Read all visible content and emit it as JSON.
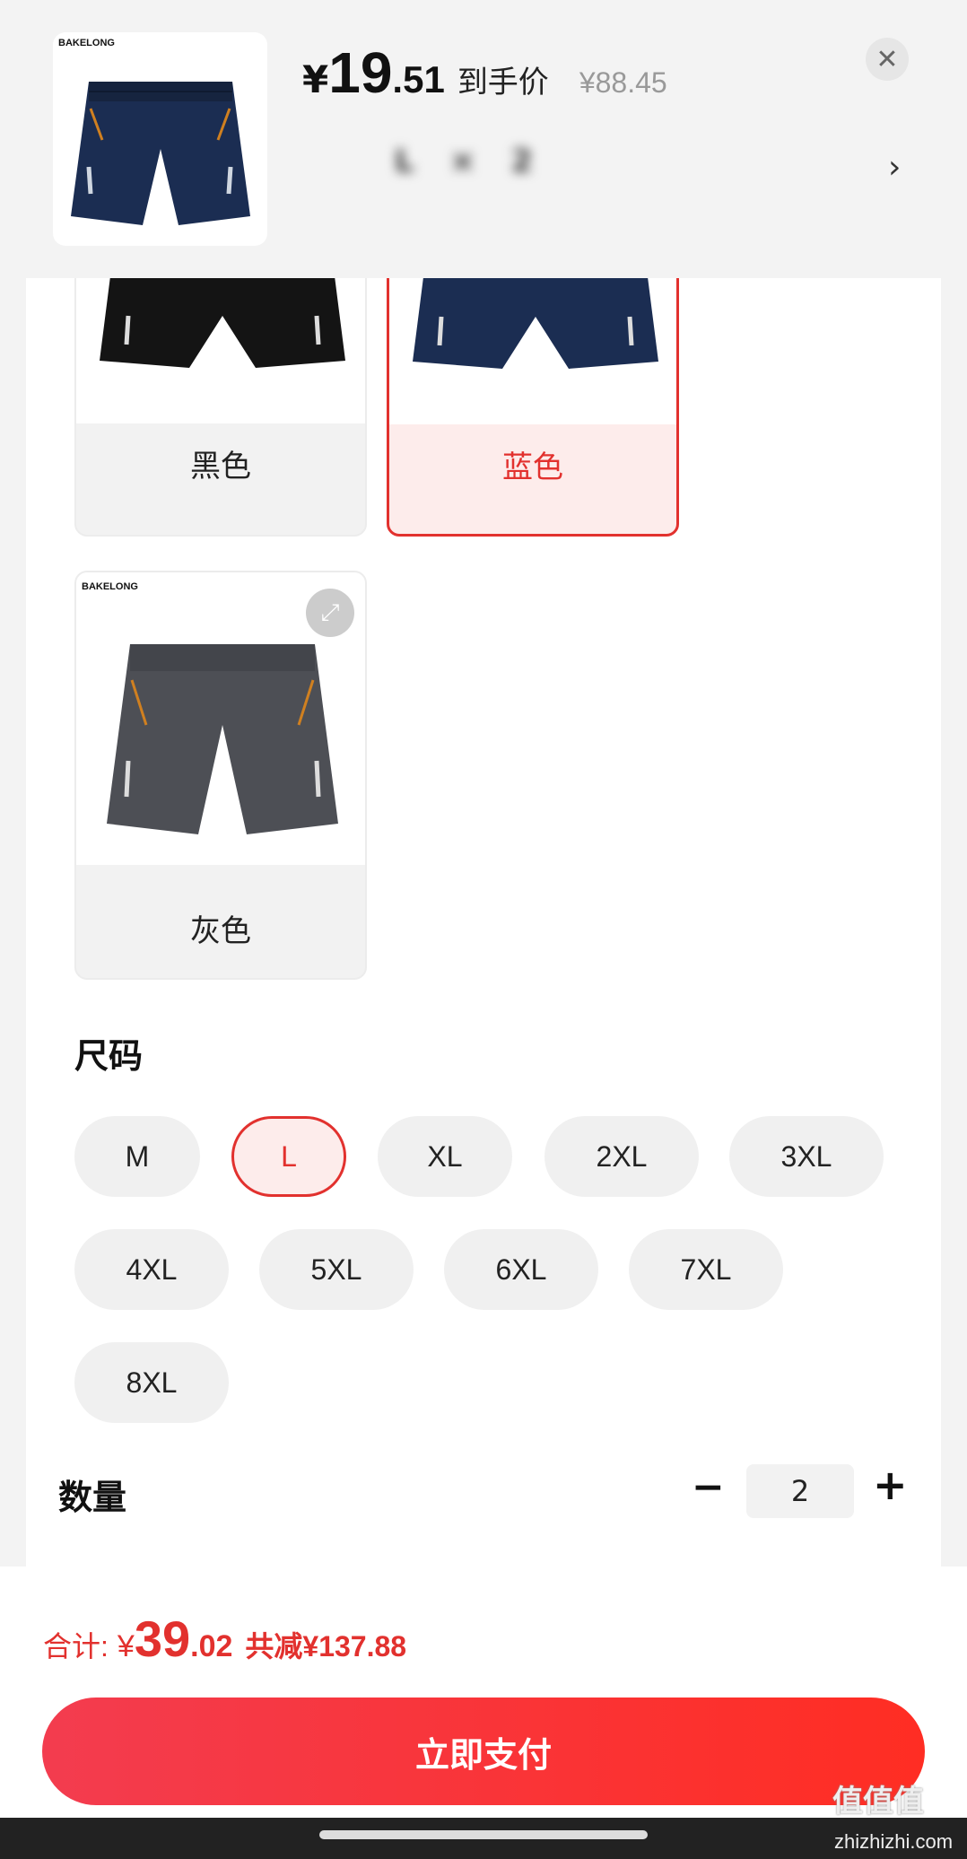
{
  "product": {
    "brand": "BAKELONG",
    "price_yen": "¥",
    "price_int": "19",
    "price_dec": ".51",
    "price_label": "到手价",
    "original_price": "¥88.45",
    "selected_summary": "L × 2"
  },
  "colors": {
    "options": [
      {
        "label": "黑色",
        "selected": false,
        "shorts_color": "#141414"
      },
      {
        "label": "蓝色",
        "selected": true,
        "shorts_color": "#1b2d52"
      },
      {
        "label": "灰色",
        "selected": false,
        "shorts_color": "#4d4f55"
      }
    ]
  },
  "sizes": {
    "title": "尺码",
    "options": [
      {
        "label": "M",
        "selected": false
      },
      {
        "label": "L",
        "selected": true
      },
      {
        "label": "XL",
        "selected": false
      },
      {
        "label": "2XL",
        "selected": false
      },
      {
        "label": "3XL",
        "selected": false
      },
      {
        "label": "4XL",
        "selected": false
      },
      {
        "label": "5XL",
        "selected": false
      },
      {
        "label": "6XL",
        "selected": false
      },
      {
        "label": "7XL",
        "selected": false
      },
      {
        "label": "8XL",
        "selected": false
      }
    ]
  },
  "quantity": {
    "title": "数量",
    "value": "2",
    "minus": "−",
    "plus": "+"
  },
  "footer": {
    "total_label": "合计:",
    "total_yen": "¥",
    "total_int": "39",
    "total_dec": ".02",
    "saved": "共减¥137.88",
    "pay_button": "立即支付"
  },
  "watermark": {
    "main": "值值值",
    "sub": "zhizhizhi.com"
  },
  "theme": {
    "accent": "#e2312e",
    "pay_gradient_start": "#f33c4f",
    "pay_gradient_end": "#ff2d23"
  }
}
